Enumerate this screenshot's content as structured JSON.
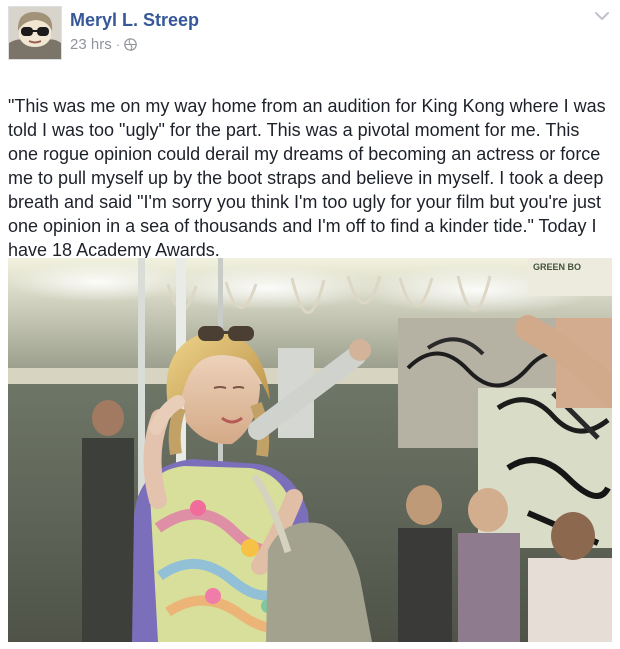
{
  "post": {
    "author_name": "Meryl L. Streep",
    "timestamp": "23 hrs",
    "separator": "·",
    "privacy_icon": "globe-icon",
    "menu_icon": "chevron-down-icon",
    "body_text": "\"This was me on my way home from an audition for King Kong where I was told I was too \"ugly\" for the part. This was a pivotal moment for me. This one rogue opinion could derail my dreams of becoming an actress or force me to pull myself up by the boot straps and believe in myself. I took a deep breath and said \"I'm sorry you think I'm too ugly for your film but you're just one opinion in a sea of thousands and I'm off to find a kinder tide.\" Today I have 18 Academy Awards.",
    "emoji_icon": "smiley-emoji-icon",
    "photo_sign_text": "GREEN BO",
    "colors": {
      "name_link": "#365899",
      "meta_gray": "#90949c",
      "body_text": "#1d2129"
    }
  }
}
